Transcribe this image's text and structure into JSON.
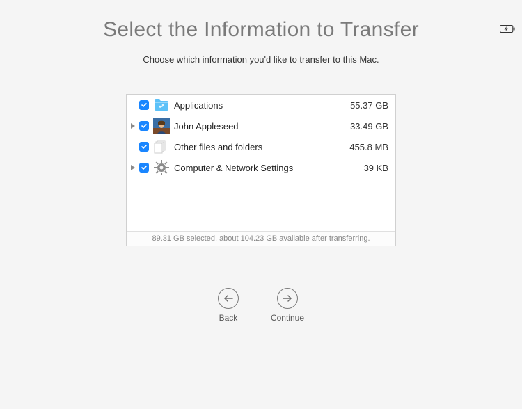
{
  "title": "Select the Information to Transfer",
  "subtitle": "Choose which information you'd like to transfer to this Mac.",
  "items": [
    {
      "label": "Applications",
      "size": "55.37 GB",
      "icon": "apps-folder-icon",
      "checked": true,
      "expandable": false
    },
    {
      "label": "John Appleseed",
      "size": "33.49 GB",
      "icon": "user-avatar-icon",
      "checked": true,
      "expandable": true
    },
    {
      "label": "Other files and folders",
      "size": "455.8 MB",
      "icon": "documents-icon",
      "checked": true,
      "expandable": false
    },
    {
      "label": "Computer & Network Settings",
      "size": "39 KB",
      "icon": "gear-icon",
      "checked": true,
      "expandable": true
    }
  ],
  "status": "89.31 GB selected, about 104.23 GB available after transferring.",
  "nav": {
    "back": "Back",
    "continue": "Continue"
  },
  "colors": {
    "checkbox": "#1a86ff",
    "bg": "#f5f5f5"
  }
}
